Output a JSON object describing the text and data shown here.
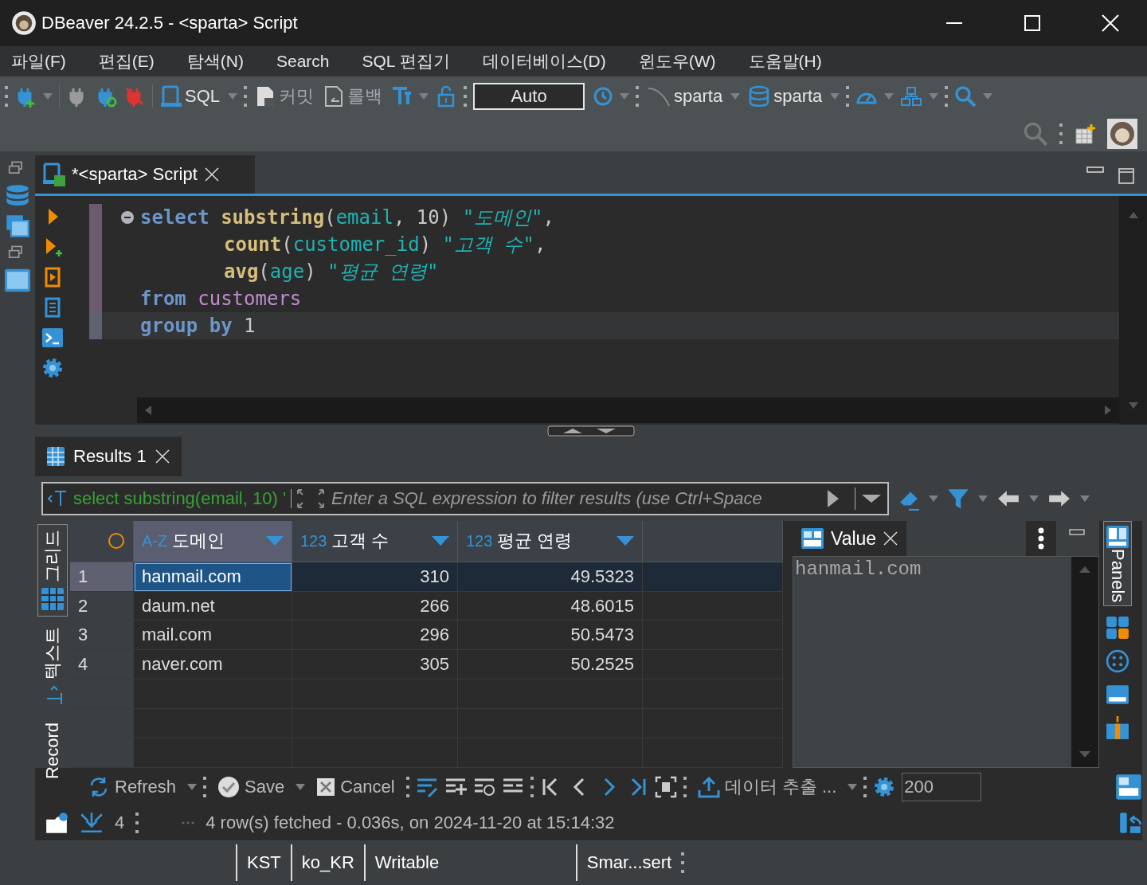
{
  "window": {
    "title": "DBeaver 24.2.5 - <sparta> Script"
  },
  "menu": [
    "파일(F)",
    "편집(E)",
    "탐색(N)",
    "Search",
    "SQL 편집기",
    "데이터베이스(D)",
    "윈도우(W)",
    "도움말(H)"
  ],
  "toolbar": {
    "sql_button": "SQL",
    "commit_button": "커밋",
    "rollback_button": "롤백",
    "transaction_mode": "Auto",
    "datasource": "sparta",
    "schema": "sparta"
  },
  "editor_tabs": [
    {
      "title": "*<sparta> Script",
      "selected": true
    }
  ],
  "editor": {
    "lines": [
      {
        "kind": "start",
        "current": false,
        "tokens": [
          {
            "kind": "keyword",
            "text": "select "
          },
          {
            "kind": "function",
            "text": "substring"
          },
          {
            "kind": "punct",
            "text": "("
          },
          {
            "kind": "column",
            "text": "email"
          },
          {
            "kind": "punct",
            "text": ", "
          },
          {
            "kind": "number",
            "text": "10"
          },
          {
            "kind": "punct",
            "text": ") "
          },
          {
            "kind": "alias",
            "text": "\"도메인\""
          },
          {
            "kind": "punct",
            "text": ","
          }
        ]
      },
      {
        "kind": "continuation",
        "current": false,
        "tokens": [
          {
            "kind": "function",
            "text": "count"
          },
          {
            "kind": "punct",
            "text": "("
          },
          {
            "kind": "column",
            "text": "customer_id"
          },
          {
            "kind": "punct",
            "text": ") "
          },
          {
            "kind": "alias",
            "text": "\"고객 수\""
          },
          {
            "kind": "punct",
            "text": ","
          }
        ]
      },
      {
        "kind": "continuation",
        "current": false,
        "tokens": [
          {
            "kind": "function",
            "text": "avg"
          },
          {
            "kind": "punct",
            "text": "("
          },
          {
            "kind": "column",
            "text": "age"
          },
          {
            "kind": "punct",
            "text": ") "
          },
          {
            "kind": "alias",
            "text": "\"평균 연령\""
          }
        ]
      },
      {
        "kind": "plain",
        "current": false,
        "tokens": [
          {
            "kind": "keyword",
            "text": "from "
          },
          {
            "kind": "table",
            "text": "customers"
          }
        ]
      },
      {
        "kind": "plain",
        "current": true,
        "tokens": [
          {
            "kind": "keyword",
            "text": "group by "
          },
          {
            "kind": "number",
            "text": "1"
          }
        ]
      }
    ]
  },
  "results_tabs": [
    {
      "title": "Results 1",
      "selected": true
    }
  ],
  "filter": {
    "query": "select substring(email, 10) '",
    "placeholder": "Enter a SQL expression to filter results (use Ctrl+Space"
  },
  "view_tabs": [
    {
      "label": "그리드",
      "selected": true
    },
    {
      "label": "텍스트",
      "selected": false
    },
    {
      "label": "Record",
      "selected": false
    }
  ],
  "grid": {
    "columns": [
      {
        "type": "A-Z",
        "name": "도메인"
      },
      {
        "type": "123",
        "name": "고객 수"
      },
      {
        "type": "123",
        "name": "평균 연령"
      }
    ],
    "rows": [
      {
        "number": "1",
        "selected": true,
        "cells": [
          "hanmail.com",
          "310",
          "49.5323"
        ]
      },
      {
        "number": "2",
        "selected": false,
        "cells": [
          "daum.net",
          "266",
          "48.6015"
        ]
      },
      {
        "number": "3",
        "selected": false,
        "cells": [
          "mail.com",
          "296",
          "50.5473"
        ]
      },
      {
        "number": "4",
        "selected": false,
        "cells": [
          "naver.com",
          "305",
          "50.2525"
        ]
      }
    ]
  },
  "value_panel": {
    "title": "Value",
    "value": "hanmail.com"
  },
  "side_panel": {
    "label": "Panels"
  },
  "bottom_toolbar": {
    "refresh": "Refresh",
    "save": "Save",
    "cancel": "Cancel",
    "export": "데이터 추출 ...",
    "fetch_size": "200"
  },
  "result_status": {
    "count": "4",
    "message": "4 row(s) fetched - 0.036s, on 2024-11-20 at 15:14:32"
  },
  "status_bar": [
    "KST",
    "ko_KR",
    "Writable",
    "Smar...sert"
  ]
}
